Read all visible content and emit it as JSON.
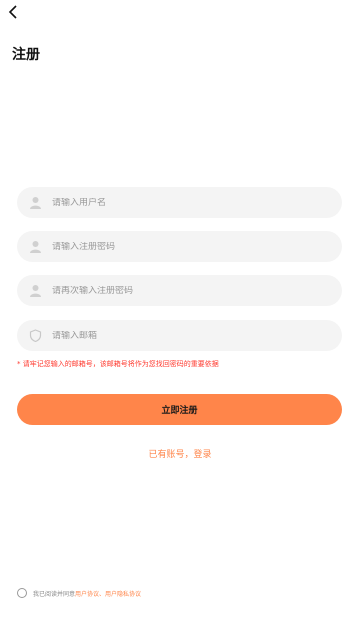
{
  "header": {
    "title": "注册"
  },
  "form": {
    "username_placeholder": "请输入用户名",
    "password_placeholder": "请输入注册密码",
    "confirm_placeholder": "请再次输入注册密码",
    "email_placeholder": "请输入邮箱"
  },
  "warning": "* 请牢记您输入的邮箱号，该邮箱号将作为您找回密码的重要依据",
  "submit_label": "立即注册",
  "login_link": "已有账号，登录",
  "agreement": {
    "prefix": "我已阅读并同意",
    "user_agreement": "用户协议",
    "sep": "、",
    "privacy": "用户隐私协议"
  },
  "colors": {
    "accent": "#ff854a",
    "field_bg": "#f4f4f4",
    "warning": "#ff3b30"
  },
  "icons": [
    "back-arrow-icon",
    "user-icon",
    "lock-icon",
    "lock-icon",
    "shield-icon"
  ]
}
